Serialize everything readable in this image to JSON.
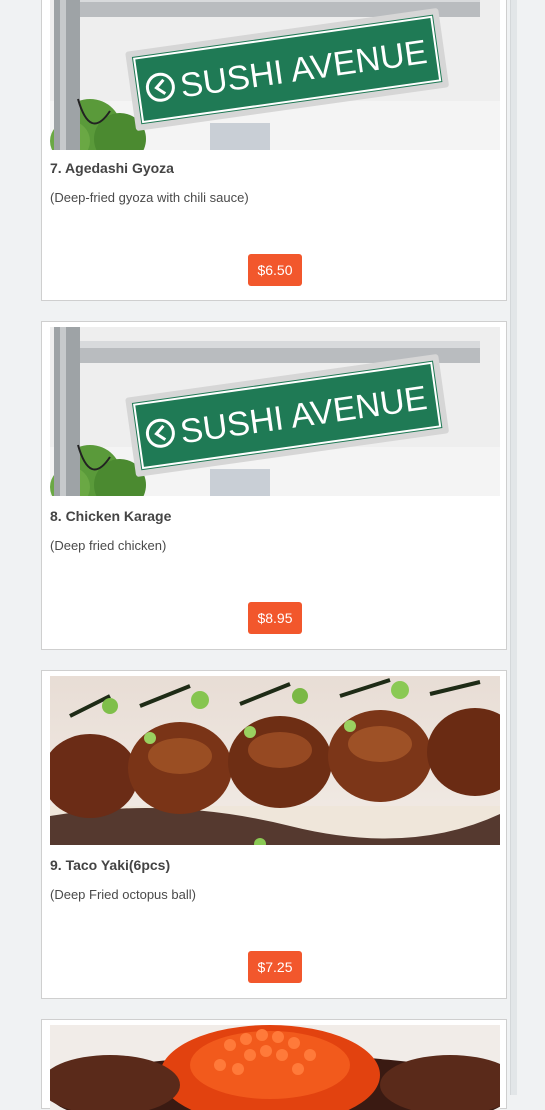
{
  "menu_items": [
    {
      "number_name": "7. Agedashi Gyoza",
      "description": "(Deep-fried gyoza with chili sauce)",
      "price": "$6.50",
      "image": "sushi-avenue-sign",
      "sign_text": "SUSHI AVENUE"
    },
    {
      "number_name": "8. Chicken Karage",
      "description": "(Deep fried chicken)",
      "price": "$8.95",
      "image": "sushi-avenue-sign",
      "sign_text": "SUSHI AVENUE"
    },
    {
      "number_name": "9. Taco Yaki(6pcs)",
      "description": "(Deep Fried octopus ball)",
      "price": "$7.25",
      "image": "glazed-seared-rolls"
    },
    {
      "image": "salmon-roe-closeup"
    }
  ],
  "colors": {
    "price_button": "#f2572c",
    "sign_green": "#1f7a55",
    "background": "#f0f2f3"
  }
}
